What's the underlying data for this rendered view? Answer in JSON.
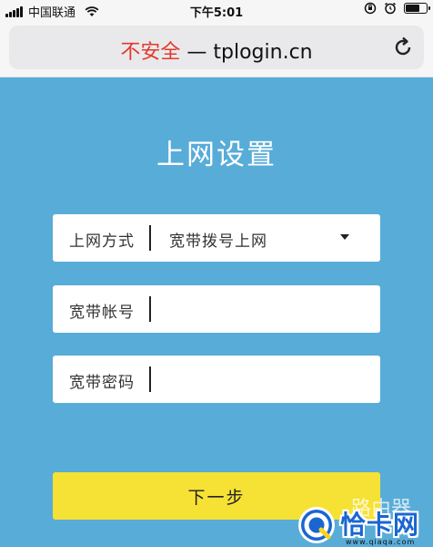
{
  "status_bar": {
    "carrier": "中国联通",
    "time": "下午5:01",
    "battery_level": 0.8
  },
  "address_bar": {
    "insecure_label": "不安全",
    "separator": " — ",
    "url": "tplogin.cn"
  },
  "main": {
    "title": "上网设置",
    "fields": {
      "connection_type": {
        "label": "上网方式",
        "value": "宽带拨号上网"
      },
      "account": {
        "label": "宽带帐号",
        "value": ""
      },
      "password": {
        "label": "宽带密码",
        "value": ""
      }
    },
    "next_button": "下一步"
  },
  "watermark": {
    "faded_text": "路由器",
    "brand": "恰卡网",
    "url": "www.qiaqa.com"
  },
  "colors": {
    "background": "#58acd8",
    "button": "#f6e135",
    "insecure": "#e23a2e",
    "watermark_brand": "#1a66d1"
  }
}
